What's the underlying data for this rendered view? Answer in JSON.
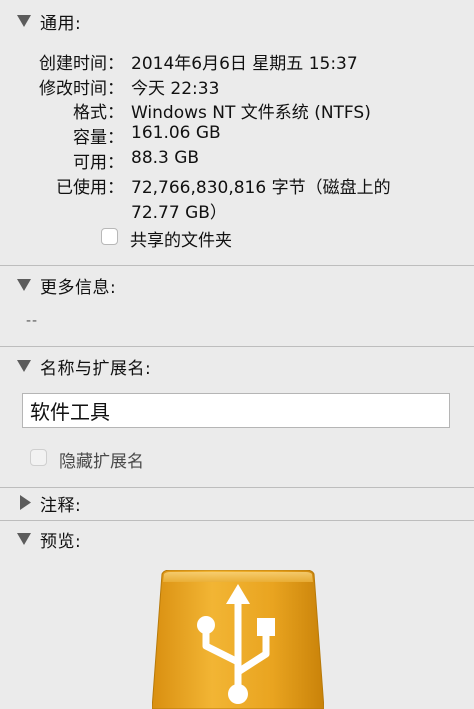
{
  "general": {
    "title": "通用:",
    "rows": [
      {
        "label": "创建时间：",
        "value": "2014年6月6日 星期五 15:37"
      },
      {
        "label": "修改时间：",
        "value": "今天 22:33"
      },
      {
        "label": "格式：",
        "value": "Windows NT 文件系统 (NTFS)"
      },
      {
        "label": "容量：",
        "value": "161.06 GB"
      },
      {
        "label": "可用：",
        "value": "88.3 GB"
      },
      {
        "label": "已使用：",
        "value": "72,766,830,816 字节（磁盘上的",
        "value2": "72.77 GB）"
      }
    ],
    "shared_folder_label": "共享的文件夹"
  },
  "more_info": {
    "title": "更多信息:",
    "placeholder": "--"
  },
  "name_ext": {
    "title": "名称与扩展名:",
    "value": "软件工具",
    "hide_ext_label": "隐藏扩展名"
  },
  "comments": {
    "title": "注释:"
  },
  "preview": {
    "title": "预览:",
    "icon": "usb-drive-icon"
  },
  "colors": {
    "drive_body": "#e6a420",
    "drive_highlight": "#f6cd6c",
    "usb_symbol": "#ffffff"
  }
}
